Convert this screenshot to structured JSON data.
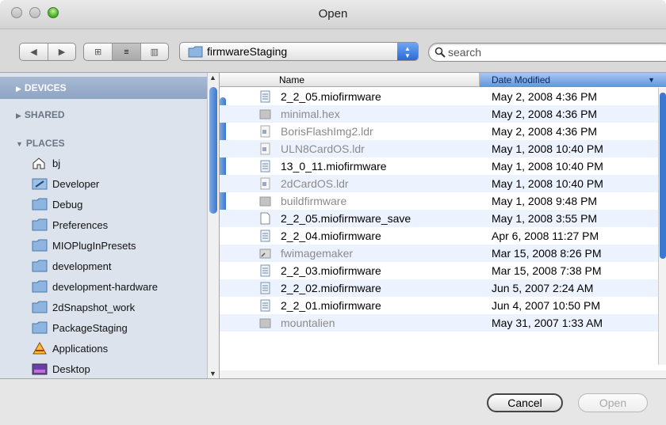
{
  "window": {
    "title": "Open"
  },
  "toolbar": {
    "back_glyph": "◀",
    "forward_glyph": "▶",
    "view_icon_glyph": "⊞",
    "view_list_glyph": "≡",
    "view_column_glyph": "▥",
    "location": "firmwareStaging",
    "search_placeholder": "search"
  },
  "sidebar": {
    "sections": {
      "devices": "DEVICES",
      "shared": "SHARED",
      "places": "PLACES"
    },
    "places": [
      {
        "label": "bj",
        "icon": "home-icon"
      },
      {
        "label": "Developer",
        "icon": "developer-folder-icon"
      },
      {
        "label": "Debug",
        "icon": "folder-icon"
      },
      {
        "label": "Preferences",
        "icon": "folder-icon"
      },
      {
        "label": "MIOPlugInPresets",
        "icon": "folder-icon"
      },
      {
        "label": "development",
        "icon": "folder-icon"
      },
      {
        "label": "development-hardware",
        "icon": "folder-icon"
      },
      {
        "label": "2dSnapshot_work",
        "icon": "folder-icon"
      },
      {
        "label": "PackageStaging",
        "icon": "folder-icon"
      },
      {
        "label": "Applications",
        "icon": "applications-icon"
      },
      {
        "label": "Desktop",
        "icon": "desktop-icon"
      }
    ]
  },
  "filelist": {
    "columns": {
      "name": "Name",
      "date": "Date Modified"
    },
    "files": [
      {
        "name": "2_2_05.miofirmware",
        "date": "May 2, 2008 4:36 PM",
        "icon": "document-icon",
        "enabled": true
      },
      {
        "name": "minimal.hex",
        "date": "May 2, 2008 4:36 PM",
        "icon": "generic-file-icon",
        "enabled": false
      },
      {
        "name": "BorisFlashImg2.ldr",
        "date": "May 2, 2008 4:36 PM",
        "icon": "ldr-file-icon",
        "enabled": false
      },
      {
        "name": "ULN8CardOS.ldr",
        "date": "May 1, 2008 10:40 PM",
        "icon": "ldr-file-icon",
        "enabled": false
      },
      {
        "name": "13_0_11.miofirmware",
        "date": "May 1, 2008 10:40 PM",
        "icon": "document-icon",
        "enabled": true
      },
      {
        "name": "2dCardOS.ldr",
        "date": "May 1, 2008 10:40 PM",
        "icon": "ldr-file-icon",
        "enabled": false
      },
      {
        "name": "buildfirmware",
        "date": "May 1, 2008 9:48 PM",
        "icon": "generic-file-icon",
        "enabled": false
      },
      {
        "name": "2_2_05.miofirmware_save",
        "date": "May 1, 2008 3:55 PM",
        "icon": "blank-file-icon",
        "enabled": true
      },
      {
        "name": "2_2_04.miofirmware",
        "date": "Apr 6, 2008 11:27 PM",
        "icon": "document-icon",
        "enabled": true
      },
      {
        "name": "fwimagemaker",
        "date": "Mar 15, 2008 8:26 PM",
        "icon": "executable-icon",
        "enabled": false
      },
      {
        "name": "2_2_03.miofirmware",
        "date": "Mar 15, 2008 7:38 PM",
        "icon": "document-icon",
        "enabled": true
      },
      {
        "name": "2_2_02.miofirmware",
        "date": "Jun 5, 2007 2:24 AM",
        "icon": "document-icon",
        "enabled": true
      },
      {
        "name": "2_2_01.miofirmware",
        "date": "Jun 4, 2007 10:50 PM",
        "icon": "document-icon",
        "enabled": true
      },
      {
        "name": "mountalien",
        "date": "May 31, 2007 1:33 AM",
        "icon": "generic-file-icon",
        "enabled": false
      }
    ]
  },
  "buttons": {
    "cancel": "Cancel",
    "open": "Open"
  }
}
